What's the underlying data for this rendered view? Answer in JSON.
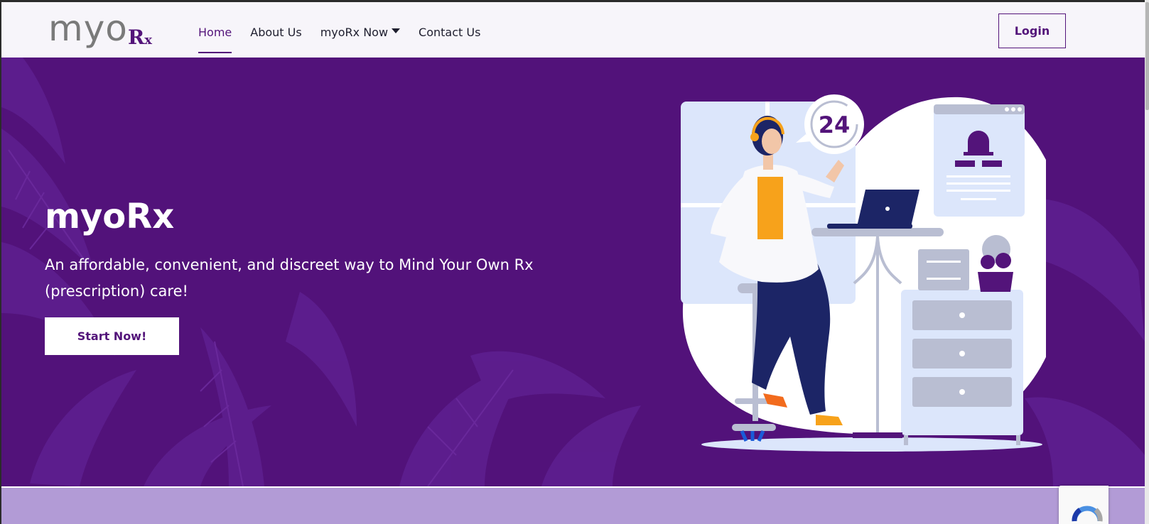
{
  "brand": {
    "logo_main": "myo",
    "logo_rx_big": "R",
    "logo_rx_small": "x"
  },
  "nav": {
    "items": [
      {
        "label": "Home",
        "active": true
      },
      {
        "label": "About Us",
        "active": false
      },
      {
        "label": "myoRx Now",
        "active": false,
        "dropdown": true
      },
      {
        "label": "Contact Us",
        "active": false
      }
    ],
    "login_label": "Login"
  },
  "hero": {
    "title": "myoRx",
    "subtitle": "An affordable, convenient, and discreet way to Mind Your Own Rx (prescription) care!",
    "cta_label": "Start Now!",
    "badge_text": "24"
  },
  "colors": {
    "brand_purple": "#53147a",
    "hero_bg": "#52127a",
    "strip_bg": "#b29bd6",
    "accent_orange": "#f7a21b",
    "navy": "#1c2566"
  },
  "icons": [
    "caret-down-icon",
    "alarm-icon",
    "laptop-icon",
    "recaptcha-icon"
  ]
}
